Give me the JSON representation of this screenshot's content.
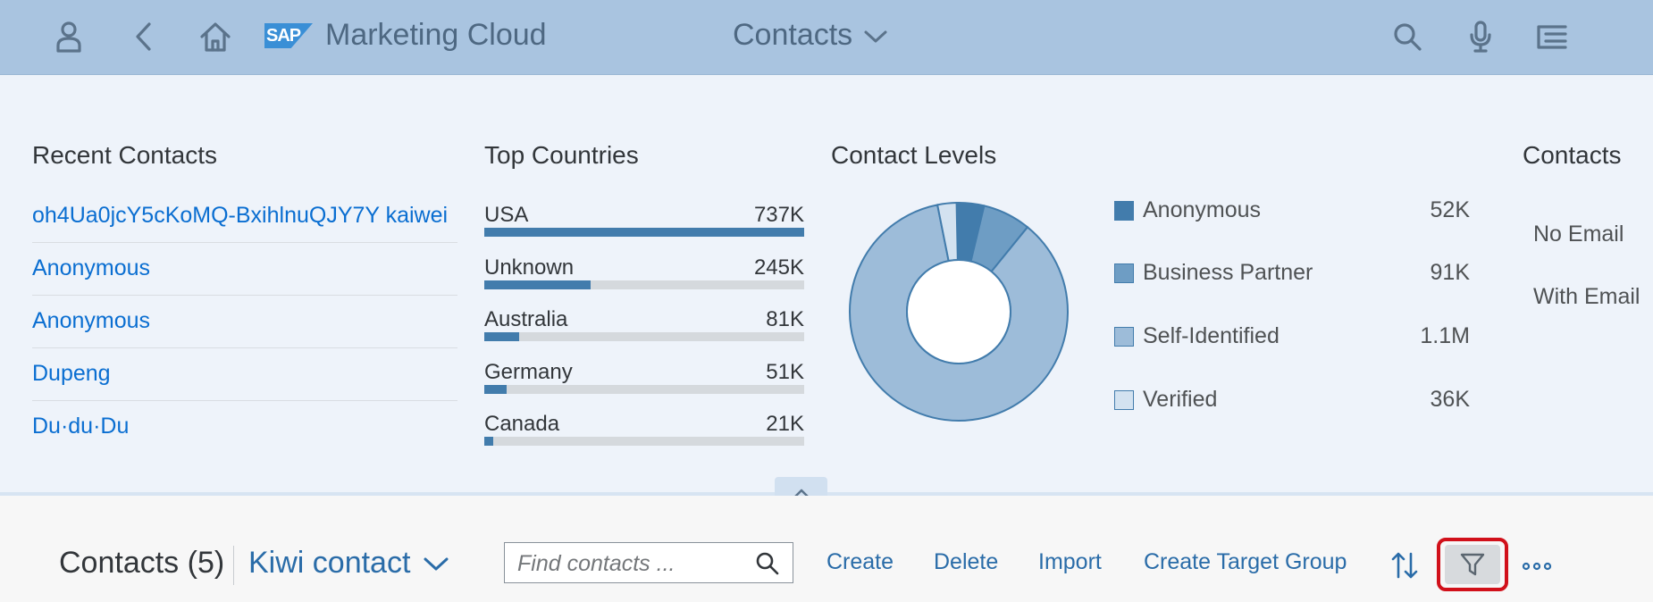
{
  "shell": {
    "logo_text": "SAP",
    "app_title": "Marketing Cloud",
    "page_title": "Contacts"
  },
  "header": {
    "recent_contacts": {
      "title": "Recent Contacts",
      "items": [
        "oh4Ua0jcY5cKoMQ-BxihlnuQJY7Y kaiwei",
        "Anonymous",
        "Anonymous",
        "Dupeng",
        "Du·du·Du"
      ]
    },
    "top_countries": {
      "title": "Top Countries",
      "items": [
        {
          "name": "USA",
          "value": "737K",
          "fraction": 1.0
        },
        {
          "name": "Unknown",
          "value": "245K",
          "fraction": 0.332
        },
        {
          "name": "Australia",
          "value": "81K",
          "fraction": 0.11
        },
        {
          "name": "Germany",
          "value": "51K",
          "fraction": 0.069
        },
        {
          "name": "Canada",
          "value": "21K",
          "fraction": 0.028
        }
      ]
    },
    "contact_levels": {
      "title": "Contact Levels",
      "legend": [
        {
          "label": "Anonymous",
          "value": "52K",
          "color": "#427cac"
        },
        {
          "label": "Business Partner",
          "value": "91K",
          "color": "#6e9dc4"
        },
        {
          "label": "Self-Identified",
          "value": "1.1M",
          "color": "#9dbcd9"
        },
        {
          "label": "Verified",
          "value": "36K",
          "color": "#d3e2f0"
        }
      ],
      "chart_data": {
        "type": "pie",
        "categories": [
          "Anonymous",
          "Business Partner",
          "Self-Identified",
          "Verified"
        ],
        "values": [
          52000,
          91000,
          1100000,
          36000
        ]
      }
    },
    "contacts_card": {
      "title": "Contacts",
      "labels": [
        "No Email",
        "With Email"
      ]
    }
  },
  "toolbar": {
    "list_title": "Contacts (5)",
    "variant": "Kiwi contact",
    "search_placeholder": "Find contacts ...",
    "actions": {
      "create": "Create",
      "delete": "Delete",
      "import": "Import",
      "create_target_group": "Create Target Group"
    }
  },
  "colors": {
    "shell_bg": "#a9c4e0",
    "link": "#0a6ed1",
    "bar_fill": "#427cac",
    "highlight": "#d1101a"
  }
}
